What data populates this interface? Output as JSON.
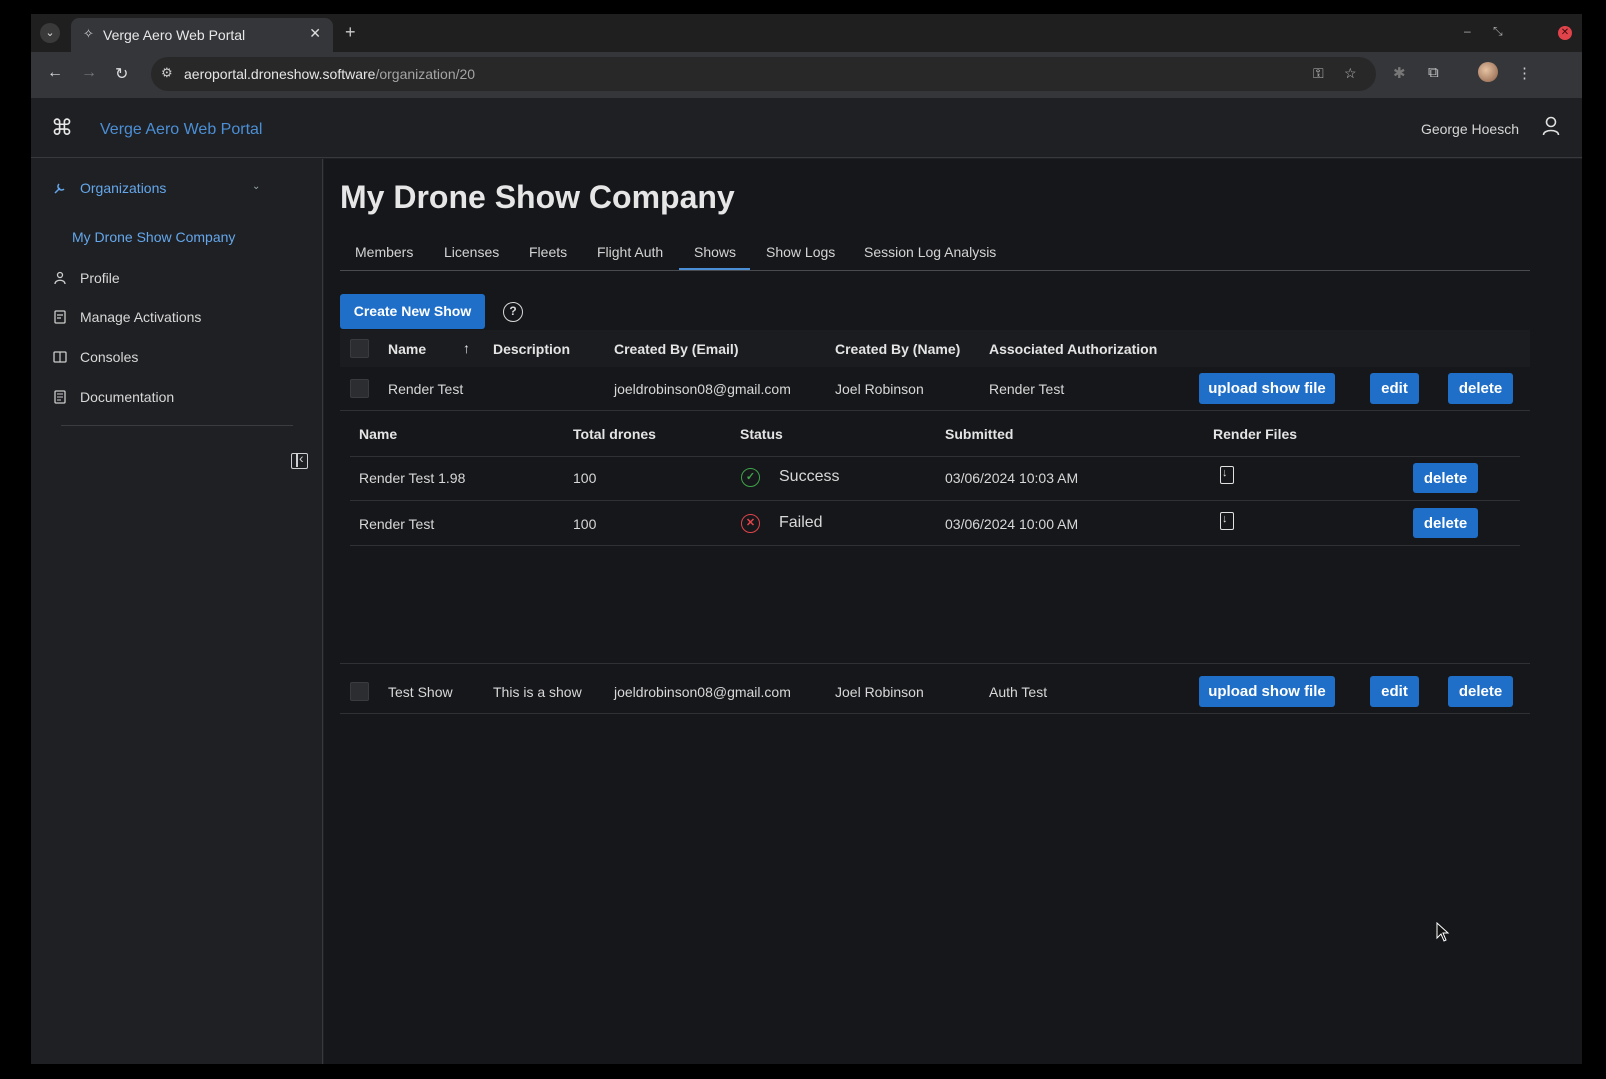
{
  "browser": {
    "tab_title": "Verge Aero Web Portal",
    "url_host": "aeroportal.droneshow.software",
    "url_path": "/organization/20",
    "icons": [
      "tab-dropdown-icon",
      "new-tab-icon",
      "back-icon",
      "forward-icon",
      "reload-icon",
      "site-info-icon",
      "password-key-icon",
      "bookmark-star-icon",
      "extensions-icon",
      "profile-avatar-icon",
      "menu-kebab-icon"
    ]
  },
  "header": {
    "app_title": "Verge Aero Web Portal",
    "user_name": "George Hoesch"
  },
  "sidebar": {
    "items": [
      {
        "label": "Organizations",
        "icon": "wrench-icon"
      },
      {
        "label": "My Drone Show Company"
      },
      {
        "label": "Profile",
        "icon": "person-icon"
      },
      {
        "label": "Manage Activations",
        "icon": "activation-icon"
      },
      {
        "label": "Consoles",
        "icon": "console-icon"
      },
      {
        "label": "Documentation",
        "icon": "document-icon"
      }
    ]
  },
  "main": {
    "page_title": "My Drone Show Company",
    "tabs": [
      "Members",
      "Licenses",
      "Fleets",
      "Flight Auth",
      "Shows",
      "Show Logs",
      "Session Log Analysis"
    ],
    "active_tab": "Shows",
    "create_button": "Create New Show",
    "columns": [
      "Name",
      "Description",
      "Created By (Email)",
      "Created By (Name)",
      "Associated Authorization"
    ],
    "sort_indicator": "↑",
    "shows": [
      {
        "name": "Render Test",
        "description": "",
        "email": "joeldrobinson08@gmail.com",
        "creator": "Joel Robinson",
        "authorization": "Render Test"
      },
      {
        "name": "Test Show",
        "description": "This is a show",
        "email": "joeldrobinson08@gmail.com",
        "creator": "Joel Robinson",
        "authorization": "Auth Test"
      }
    ],
    "row_actions": {
      "upload": "upload show file",
      "edit": "edit",
      "delete": "delete"
    },
    "render_columns": [
      "Name",
      "Total drones",
      "Status",
      "Submitted",
      "Render Files"
    ],
    "renders": [
      {
        "name": "Render Test 1.98",
        "drones": "100",
        "status": "Success",
        "submitted": "03/06/2024 10:03 AM",
        "delete": "delete"
      },
      {
        "name": "Render Test",
        "drones": "100",
        "status": "Failed",
        "submitted": "03/06/2024 10:00 AM",
        "delete": "delete"
      }
    ],
    "colors": {
      "accent": "#1f6fc9",
      "link": "#4b8fd6",
      "success": "#3ea34a",
      "failed": "#e0434a"
    }
  }
}
